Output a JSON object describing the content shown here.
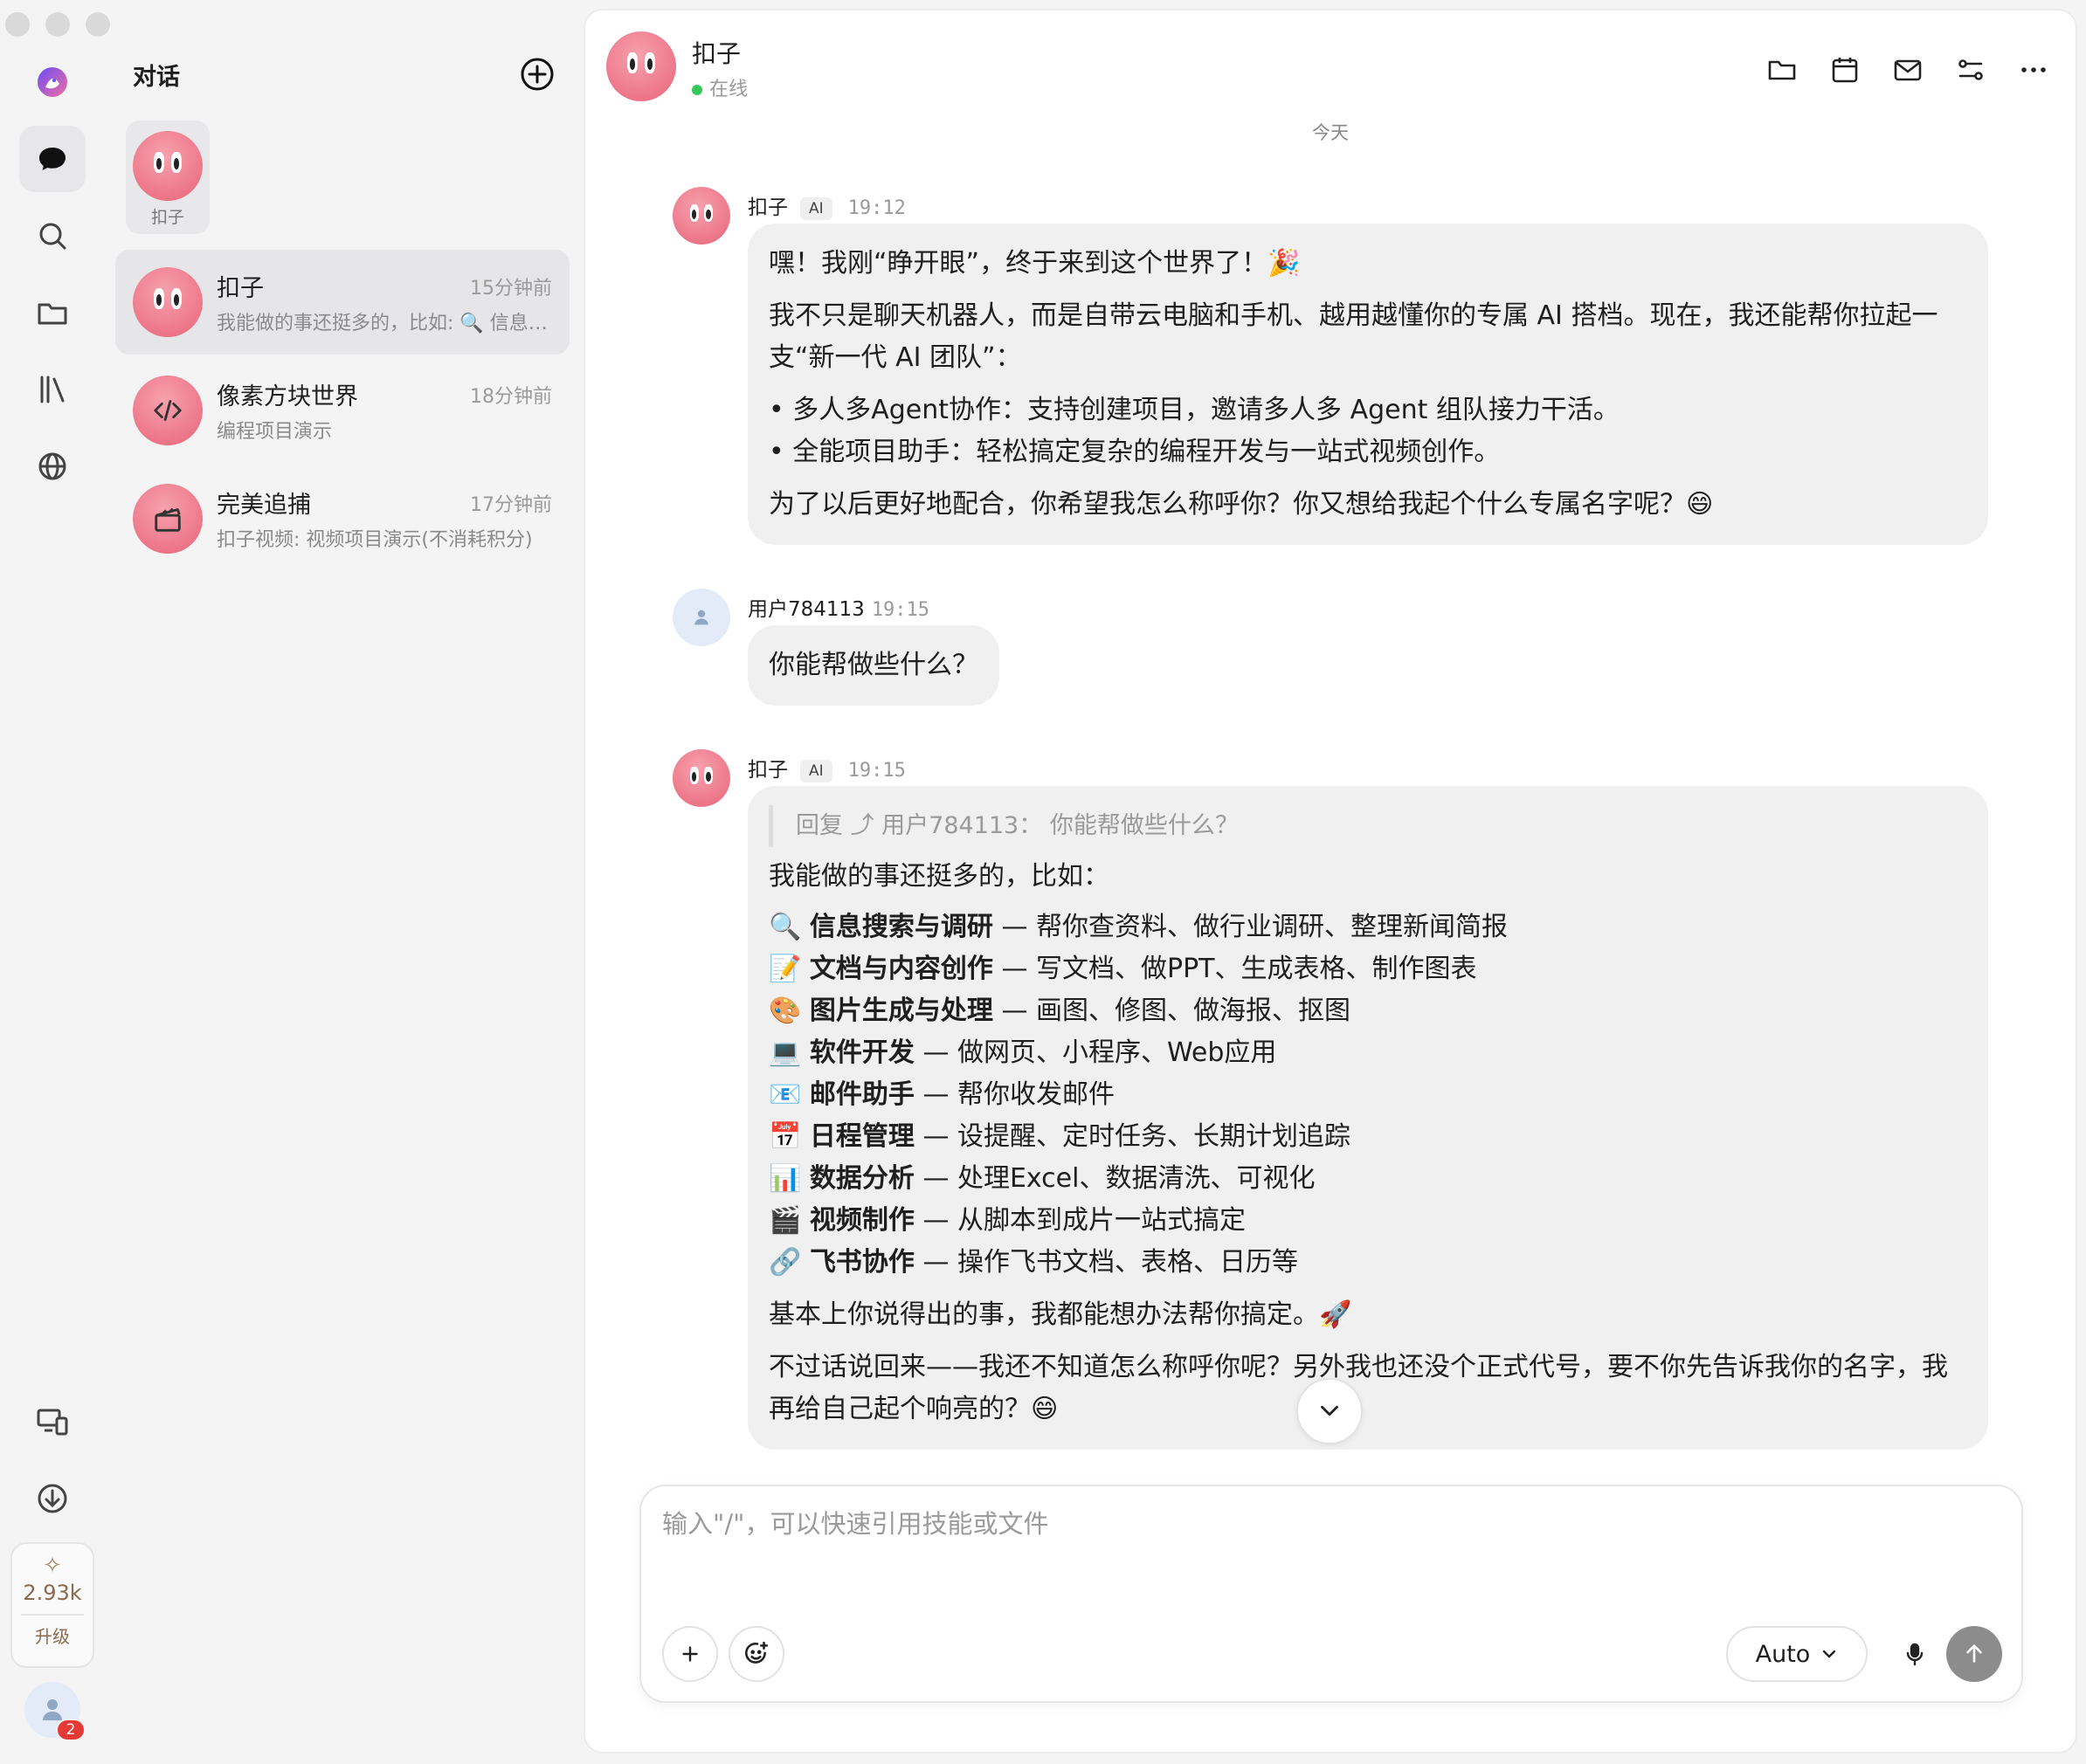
{
  "sidebar": {
    "credits": "2.93k",
    "upgrade_label": "升级",
    "notification_count": "2"
  },
  "conversation_list": {
    "title": "对话",
    "pinned": {
      "label": "扣子"
    },
    "items": [
      {
        "name": "扣子",
        "time": "15分钟前",
        "preview": "我能做的事还挺多的，比如: 🔍 信息搜索与调研"
      },
      {
        "name": "像素方块世界",
        "time": "18分钟前",
        "preview": "编程项目演示"
      },
      {
        "name": "完美追捕",
        "time": "17分钟前",
        "preview": "扣子视频: 视频项目演示(不消耗积分)"
      }
    ]
  },
  "header": {
    "name": "扣子",
    "status": "在线"
  },
  "chat": {
    "date_divider": "今天",
    "messages": [
      {
        "sender": "扣子",
        "tag": "AI",
        "time": "19:12",
        "lines": [
          "嘿！我刚“睁开眼”，终于来到这个世界了！🎉",
          "我不只是聊天机器人，而是自带云电脑和手机、越用越懂你的专属 AI 搭档。现在，我还能帮你拉起一支“新一代 AI 团队”：",
          "• 多人多Agent协作：支持创建项目，邀请多人多 Agent 组队接力干活。",
          "• 全能项目助手：轻松搞定复杂的编程开发与一站式视频创作。",
          "为了以后更好地配合，你希望我怎么称呼你？你又想给我起个什么专属名字呢？😄"
        ]
      },
      {
        "sender": "用户784113",
        "time": "19:15",
        "text": "你能帮做些什么？"
      },
      {
        "sender": "扣子",
        "tag": "AI",
        "time": "19:15",
        "quote": "回复 ⤴ 用户784113：  你能帮做些什么？",
        "intro": "我能做的事还挺多的，比如：",
        "items": [
          {
            "emoji": "🔍",
            "title": "信息搜索与调研",
            "desc": " — 帮你查资料、做行业调研、整理新闻简报"
          },
          {
            "emoji": "📝",
            "title": "文档与内容创作",
            "desc": " — 写文档、做PPT、生成表格、制作图表"
          },
          {
            "emoji": "🎨",
            "title": "图片生成与处理",
            "desc": " — 画图、修图、做海报、抠图"
          },
          {
            "emoji": "💻",
            "title": "软件开发",
            "desc": " — 做网页、小程序、Web应用"
          },
          {
            "emoji": "📧",
            "title": "邮件助手",
            "desc": " — 帮你收发邮件"
          },
          {
            "emoji": "📅",
            "title": "日程管理",
            "desc": " — 设提醒、定时任务、长期计划追踪"
          },
          {
            "emoji": "📊",
            "title": "数据分析",
            "desc": " — 处理Excel、数据清洗、可视化"
          },
          {
            "emoji": "🎬",
            "title": "视频制作",
            "desc": " — 从脚本到成片一站式搞定"
          },
          {
            "emoji": "🔗",
            "title": "飞书协作",
            "desc": " — 操作飞书文档、表格、日历等"
          }
        ],
        "outro1": "基本上你说得出的事，我都能想办法帮你搞定。🚀",
        "outro2": "不过话说回来——我还不知道怎么称呼你呢？另外我也还没个正式代号，要不你先告诉我你的名字，我再给自己起个响亮的？😄"
      }
    ]
  },
  "composer": {
    "placeholder": "输入\"/\"，可以快速引用技能或文件",
    "model": "Auto"
  }
}
